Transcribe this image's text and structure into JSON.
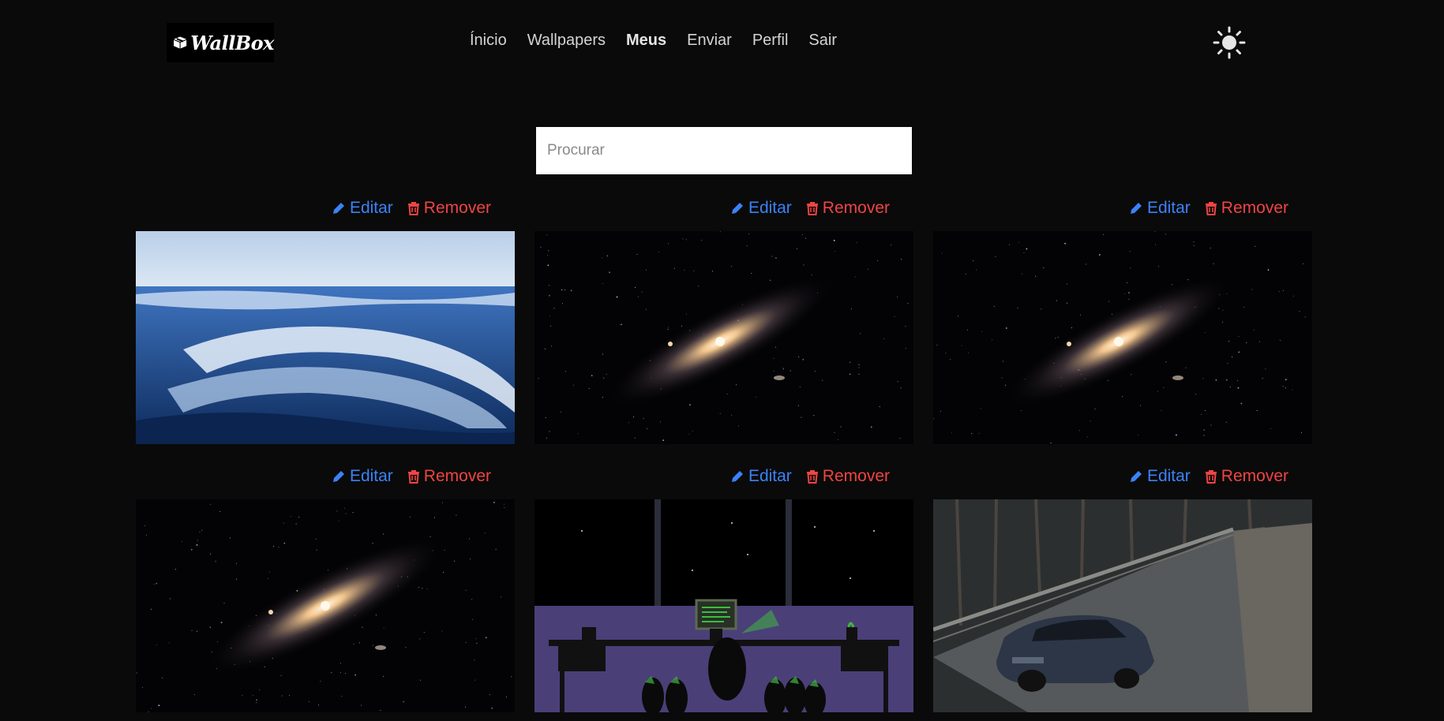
{
  "brand": {
    "name": "WallBox"
  },
  "nav": {
    "items": [
      {
        "label": "Ínicio",
        "active": false
      },
      {
        "label": "Wallpapers",
        "active": false
      },
      {
        "label": "Meus",
        "active": true
      },
      {
        "label": "Enviar",
        "active": false
      },
      {
        "label": "Perfil",
        "active": false
      },
      {
        "label": "Sair",
        "active": false
      }
    ],
    "theme_icon": "sun-icon"
  },
  "search": {
    "placeholder": "Procurar",
    "value": ""
  },
  "actions": {
    "edit_label": "Editar",
    "remove_label": "Remover"
  },
  "colors": {
    "background": "#0a0a0a",
    "edit": "#3b82f6",
    "remove": "#ef4444"
  },
  "wallpapers": [
    {
      "subject": "ocean-waves"
    },
    {
      "subject": "galaxy"
    },
    {
      "subject": "galaxy"
    },
    {
      "subject": "galaxy"
    },
    {
      "subject": "penguin-desk-night"
    },
    {
      "subject": "car-on-road"
    }
  ]
}
